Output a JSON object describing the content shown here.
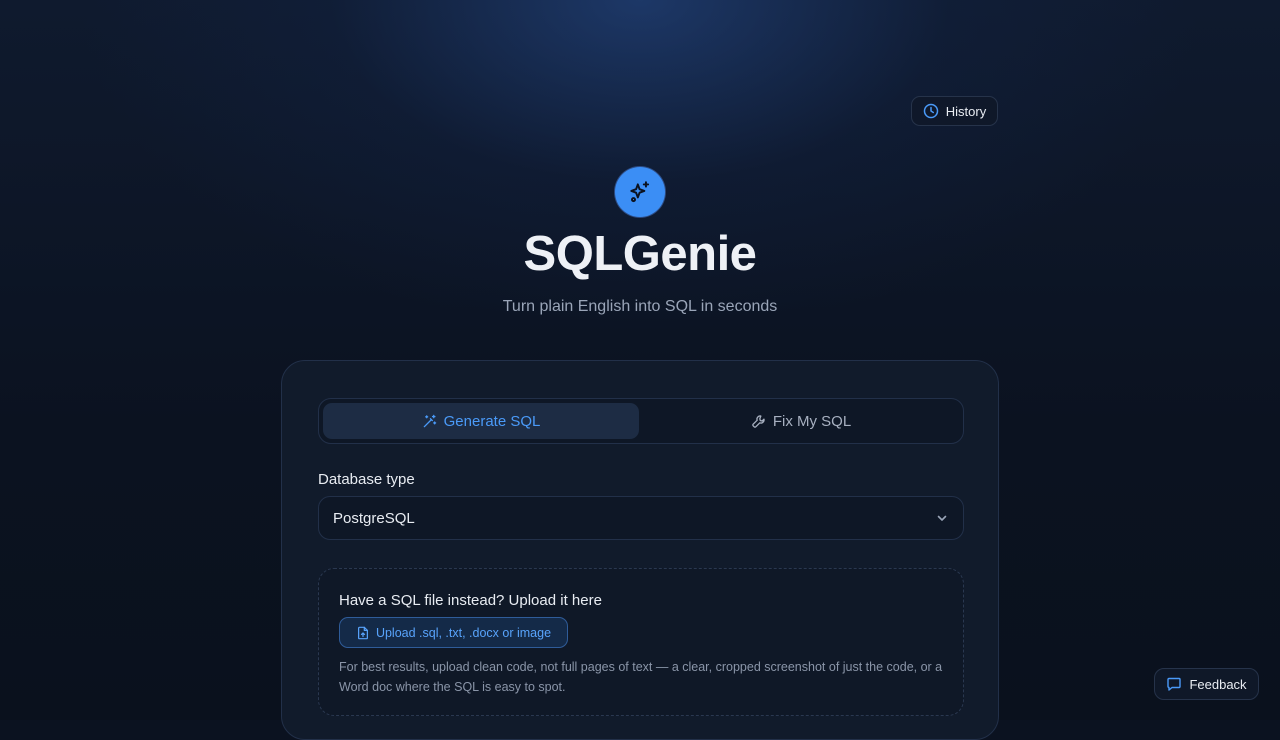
{
  "header": {
    "history_label": "History",
    "app_title": "SQLGenie",
    "subtitle": "Turn plain English into SQL in seconds"
  },
  "tabs": [
    {
      "label": "Generate SQL",
      "active": true
    },
    {
      "label": "Fix My SQL",
      "active": false
    }
  ],
  "form": {
    "db_label": "Database type",
    "db_value": "PostgreSQL"
  },
  "upload": {
    "title": "Have a SQL file instead? Upload it here",
    "button_label": "Upload .sql, .txt, .docx or image",
    "hint": "For best results, upload clean code, not full pages of text — a clear, cropped screenshot of just the code, or a Word doc where the SQL is easy to spot."
  },
  "feedback_label": "Feedback",
  "colors": {
    "accent": "#3b8ef5",
    "background": "#0b1220",
    "card": "#111b2b"
  },
  "icons": [
    "clock-icon",
    "sparkles-icon",
    "magic-wand-icon",
    "wrench-icon",
    "chevron-down-icon",
    "file-upload-icon",
    "message-icon"
  ]
}
